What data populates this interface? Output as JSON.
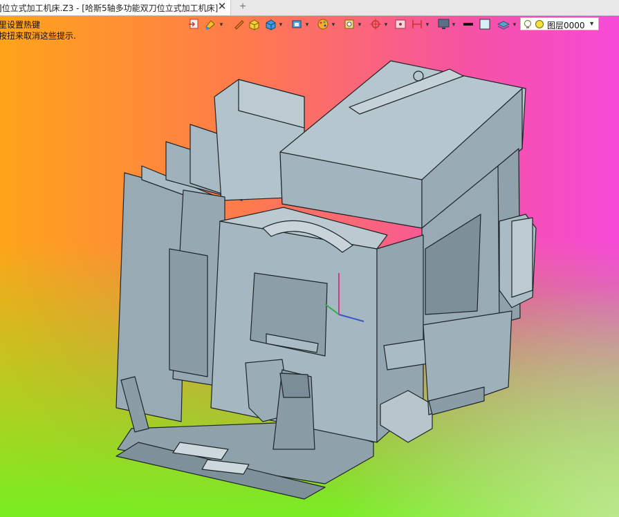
{
  "window": {
    "tab_title": "]位立式加工机床.Z3 - [哈斯5轴多功能双刀位立式加工机床]",
    "close_glyph": "✕",
    "add_glyph": "+"
  },
  "hints": [
    "里设置热键",
    "按扭来取消这些提示."
  ],
  "toolbar": {
    "icons": [
      "import-icon",
      "paint-bucket-icon",
      "pencil-icon",
      "render-cube-icon",
      "cube-view-icon",
      "cube-dropdown-icon",
      "palette-icon",
      "zoom-box-icon",
      "crosshair-icon",
      "screen-icon",
      "measure-icon",
      "monitor-icon",
      "line-style-icon",
      "color-swatch-icon",
      "layer-stack-icon"
    ],
    "layer": {
      "value": "图层0000",
      "bulb_icon": "bulb-icon",
      "color_icon": "layer-color-icon"
    }
  },
  "viewport": {
    "content": "3D CAD model of 5-axis vertical machining center",
    "model_color": "#a4b7c1",
    "edge_color": "#1d2428"
  }
}
